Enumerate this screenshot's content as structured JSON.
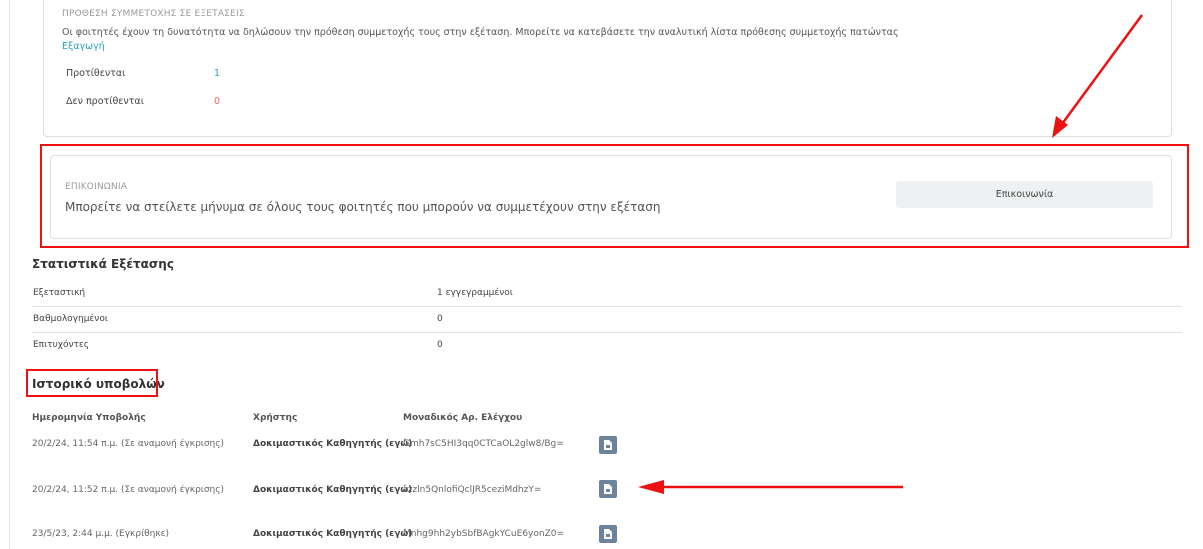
{
  "intent": {
    "title": "ΠΡΟΘΕΣΗ ΣΥΜΜΕΤΟΧΗΣ ΣΕ ΕΞΕΤΑΣΕΙΣ",
    "description": "Οι φοιτητές έχουν τη δυνατότητα να δηλώσουν την πρόθεση συμμετοχής τους στην εξέταση. Μπορείτε να κατεβάσετε την αναλυτική λίστα πρόθεσης συμμετοχής πατώντας",
    "export_link": "Εξαγωγή",
    "rows": [
      {
        "label": "Προτίθενται",
        "value": "1"
      },
      {
        "label": "Δεν προτίθενται",
        "value": "0"
      }
    ],
    "colors": {
      "yes": "#2aa1c0",
      "no": "#e8685b"
    }
  },
  "contact": {
    "title": "ΕΠΙΚΟΙΝΩΝΙΑ",
    "description": "Μπορείτε να στείλετε μήνυμα σε όλους τους φοιτητές που μπορούν να συμμετέχουν στην εξέταση",
    "button_label": "Επικοινωνία"
  },
  "stats": {
    "title": "Στατιστικά Εξέτασης",
    "rows": [
      {
        "label": "Εξεταστική",
        "value": "1 εγγεγραμμένοι"
      },
      {
        "label": "Βαθμολογημένοι",
        "value": "0"
      },
      {
        "label": "Επιτυχόντες",
        "value": "0"
      }
    ]
  },
  "history": {
    "title": "Ιστορικό υποβολών",
    "headers": {
      "date": "Ημερομηνία Υποβολής",
      "user": "Χρήστης",
      "code": "Μοναδικός Αρ. Ελέγχου"
    },
    "rows": [
      {
        "date": "20/2/24, 11:54 π.μ. (Σε αναμονή έγκρισης)",
        "user": "Δοκιμαστικός Καθηγητής (εγώ)",
        "code": "Gmh7sC5HI3qq0CTCaOL2glw8/Bg=",
        "icon": "pdf-icon"
      },
      {
        "date": "20/2/24, 11:52 π.μ. (Σε αναμονή έγκρισης)",
        "user": "Δοκιμαστικός Καθηγητής (εγώ)",
        "code": "zzzln5QnlofiQclJR5ceziMdhzY=",
        "icon": "pdf-icon"
      },
      {
        "date": "23/5/23, 2:44 μ.μ. (Εγκρίθηκε)",
        "user": "Δοκιμαστικός Καθηγητής (εγώ)",
        "code": "Mnhg9hh2ybSbfBAgkYCuE6yonZ0=",
        "icon": "pdf-icon"
      }
    ]
  },
  "annotations": {
    "color": "#ee1111"
  }
}
